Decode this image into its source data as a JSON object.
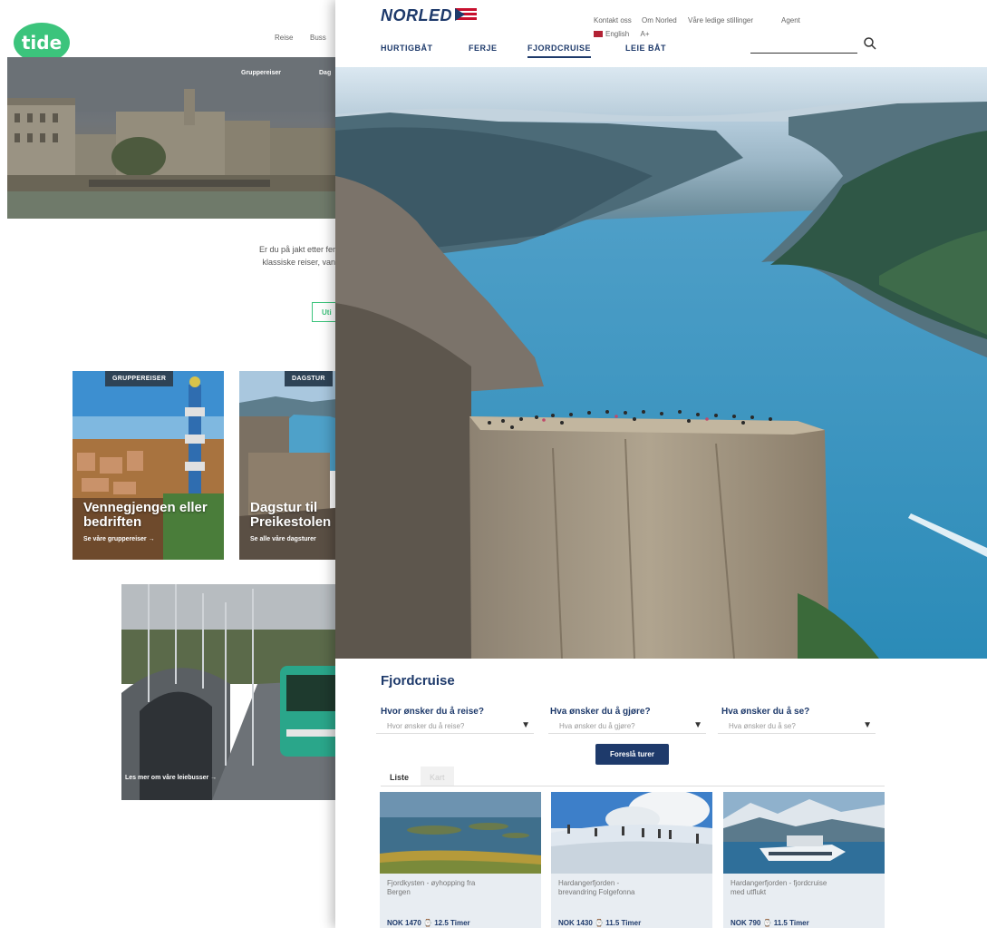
{
  "tide": {
    "logo_text": "tide",
    "nav": [
      "Reise",
      "Buss"
    ],
    "hero_subnav": [
      "Gruppereiser",
      "Dag"
    ],
    "intro_line1": "Er du på jakt etter fer",
    "intro_line2": "klassiske reiser, van",
    "intro_button": "Uti",
    "cards": [
      {
        "tag": "GRUPPEREISER",
        "title": "Vennegjengen eller bedriften",
        "link": "Se våre gruppereiser →"
      },
      {
        "tag": "DAGSTUR",
        "title": "Dagstur til Preikestolen",
        "link": "Se alle våre dagsturer"
      },
      {
        "tag": "",
        "title": "",
        "link": "Les mer om våre leiebusser →"
      }
    ]
  },
  "norled": {
    "logo_text": "NORLED",
    "utility_links": [
      "Kontakt oss",
      "Om Norled",
      "Våre ledige stillinger",
      "Agent"
    ],
    "language": "English",
    "font_size_toggle": "A+",
    "nav": [
      {
        "label": "HURTIGBÅT",
        "active": false
      },
      {
        "label": "FERJE",
        "active": false
      },
      {
        "label": "FJORDCRUISE",
        "active": true
      },
      {
        "label": "LEIE BÅT",
        "active": false
      }
    ],
    "section_title": "Fjordcruise",
    "filters": [
      {
        "label": "Hvor ønsker du å reise?",
        "placeholder": "Hvor ønsker du å reise?"
      },
      {
        "label": "Hva ønsker du å gjøre?",
        "placeholder": "Hva ønsker du å gjøre?"
      },
      {
        "label": "Hva ønsker du å se?",
        "placeholder": "Hva ønsker du å se?"
      }
    ],
    "suggest_button": "Foreslå turer",
    "tabs": [
      "Liste",
      "Kart"
    ],
    "tours": [
      {
        "name": "Fjordkysten - øyhopping fra Bergen",
        "price": "NOK 1470 ⌚ 12.5 Timer"
      },
      {
        "name": "Hardangerfjorden - brevandring Folgefonna",
        "price": "NOK 1430 ⌚ 11.5 Timer"
      },
      {
        "name": "Hardangerfjorden - fjordcruise med utflukt",
        "price": "NOK 790 ⌚ 11.5 Timer"
      }
    ]
  },
  "colors": {
    "tide_green": "#3cc47c",
    "norled_navy": "#1e3a6b",
    "tag_bg": "#2e4356"
  }
}
